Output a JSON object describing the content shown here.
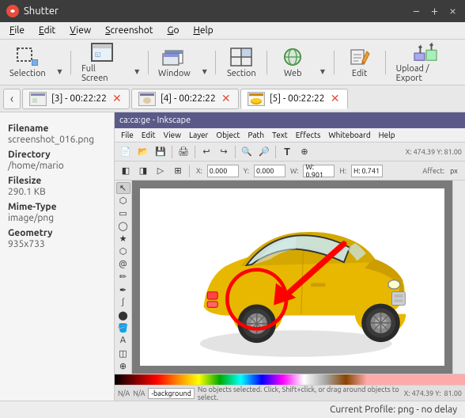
{
  "titlebar": {
    "title": "Shutter",
    "icon": "S",
    "controls": [
      "−",
      "+",
      "×"
    ]
  },
  "menubar": {
    "items": [
      "File",
      "Edit",
      "View",
      "Screenshot",
      "Go",
      "Help"
    ]
  },
  "toolbar": {
    "buttons": [
      {
        "id": "selection",
        "label": "Selection",
        "icon": "⬚"
      },
      {
        "id": "fullscreen",
        "label": "Full Screen",
        "icon": "⛶"
      },
      {
        "id": "window",
        "label": "Window",
        "icon": "🗔"
      },
      {
        "id": "section",
        "label": "Section",
        "icon": "▦"
      },
      {
        "id": "web",
        "label": "Web",
        "icon": "🌐"
      },
      {
        "id": "edit",
        "label": "Edit",
        "icon": "✏"
      },
      {
        "id": "upload",
        "label": "Upload / Export",
        "icon": "⬆"
      }
    ]
  },
  "tabs": {
    "items": [
      {
        "id": "tab1",
        "label": "[3] - 00:22:22",
        "active": false
      },
      {
        "id": "tab2",
        "label": "[4] - 00:22:22",
        "active": false
      },
      {
        "id": "tab3",
        "label": "[5] - 00:22:22",
        "active": true
      }
    ]
  },
  "info_panel": {
    "filename_label": "Filename",
    "filename_value": "screenshot_016.png",
    "directory_label": "Directory",
    "directory_value": "/home/mario",
    "filesize_label": "Filesize",
    "filesize_value": "290.1 KB",
    "mimetype_label": "Mime-Type",
    "mimetype_value": "image/png",
    "geometry_label": "Geometry",
    "geometry_value": "935x733"
  },
  "inkscape": {
    "titlebar": "ca:ca:ge - Inkscape",
    "menubar": [
      "File",
      "Edit",
      "View",
      "Layer",
      "Object",
      "Path",
      "Text",
      "Effects",
      "Whiteboard",
      "Help"
    ],
    "status": "No objects selected. Click, Shift+click, or drag around objects to select.",
    "coords": "X: 474.39  Y: 81.00",
    "colorbar_text": "-background"
  },
  "statusbar": {
    "text": "Current Profile: png - no delay"
  }
}
